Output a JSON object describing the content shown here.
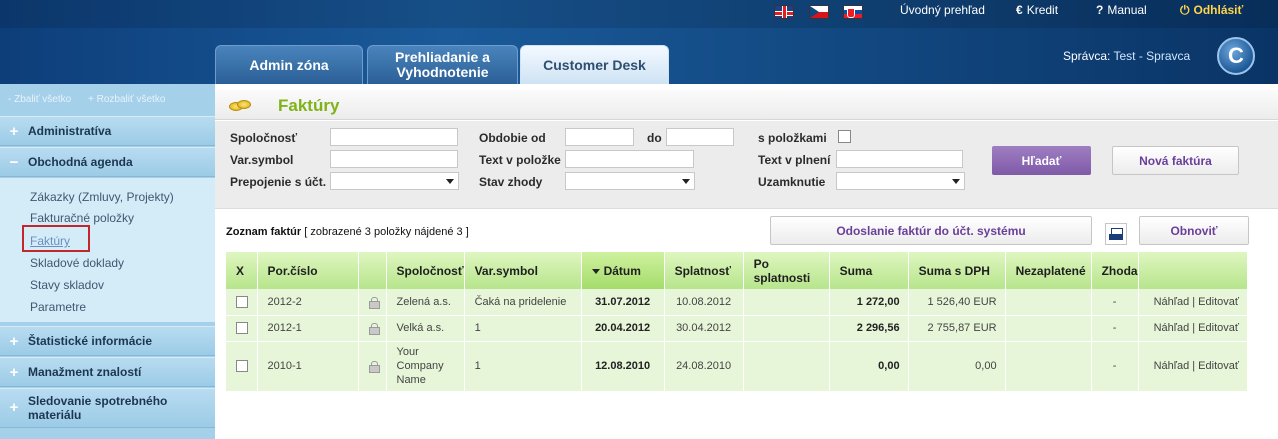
{
  "header": {
    "languages": [
      "en-flag-icon",
      "cz-flag-icon",
      "sk-flag-icon"
    ],
    "links": {
      "overview": "Úvodný prehľad",
      "credit": "Kredit",
      "manual": "Manual",
      "logout": "Odhlásiť"
    },
    "icons": {
      "credit": "€",
      "manual": "?",
      "logout": "⏻"
    },
    "tabs": [
      {
        "label": "Admin zóna"
      },
      {
        "label": "Prehliadanie a Vyhodnotenie"
      },
      {
        "label": "Customer Desk"
      }
    ],
    "admin_prefix": "Správca:",
    "admin_name": "Test - Spravca",
    "logo_letter": "C"
  },
  "sidebar": {
    "collapse_all": "- Zbaliť všetko",
    "expand_all": "+ Rozbaliť všetko",
    "sections": [
      {
        "sign": "+",
        "label": "Administratíva"
      },
      {
        "sign": "−",
        "label": "Obchodná agenda"
      },
      {
        "sign": "+",
        "label": "Štatistické informácie"
      },
      {
        "sign": "+",
        "label": "Manažment znalostí"
      },
      {
        "sign": "+",
        "label": "Sledovanie spotrebného materiálu"
      }
    ],
    "items": [
      {
        "label": "Zákazky (Zmluvy, Projekty)"
      },
      {
        "label": "Fakturačné položky"
      },
      {
        "label": "Faktúry"
      },
      {
        "label": "Skladové doklady"
      },
      {
        "label": "Stavy skladov"
      },
      {
        "label": "Parametre"
      }
    ]
  },
  "page": {
    "title": "Faktúry"
  },
  "filter": {
    "company_label": "Spoločnosť",
    "varsymbol_label": "Var.symbol",
    "link_label": "Prepojenie s účt.",
    "period_label": "Obdobie od",
    "to_label": "do",
    "item_text_label": "Text v položke",
    "match_label": "Stav zhody",
    "with_items_label": "s položkami",
    "fulfilment_label": "Text v plnení",
    "locked_label": "Uzamknutie",
    "search_button": "Hľadať",
    "new_invoice_button": "Nová faktúra"
  },
  "list": {
    "title": "Zoznam faktúr",
    "count": "[ zobrazené 3 položky nájdené 3 ]",
    "send_button": "Odoslanie faktúr do účt. systému",
    "refresh_button": "Obnoviť",
    "columns": [
      "X",
      "Por.číslo",
      "",
      "Spoločnosť",
      "Var.symbol",
      "Dátum",
      "Splatnosť",
      "Po splatnosti",
      "Suma",
      "Suma s DPH",
      "Nezaplatené",
      "Zhoda",
      ""
    ],
    "rows": [
      {
        "number": "2012-2",
        "company": "Zelená a.s.",
        "varsymbol": "Čaká na pridelenie",
        "date": "31.07.2012",
        "due": "10.08.2012",
        "overdue": "",
        "sum": "1 272,00",
        "sum_vat": "1 526,40 EUR",
        "unpaid": "",
        "match": "-",
        "actions": "Náhľad | Editovať"
      },
      {
        "number": "2012-1",
        "company": "Velká a.s.",
        "varsymbol": "1",
        "date": "20.04.2012",
        "due": "30.04.2012",
        "overdue": "",
        "sum": "2 296,56",
        "sum_vat": "2 755,87 EUR",
        "unpaid": "",
        "match": "-",
        "actions": "Náhľad | Editovať"
      },
      {
        "number": "2010-1",
        "company": "Your Company Name",
        "varsymbol": "1",
        "date": "12.08.2010",
        "due": "24.08.2010",
        "overdue": "",
        "sum": "0,00",
        "sum_vat": "0,00",
        "unpaid": "",
        "match": "-",
        "actions": "Náhľad | Editovať"
      }
    ]
  }
}
